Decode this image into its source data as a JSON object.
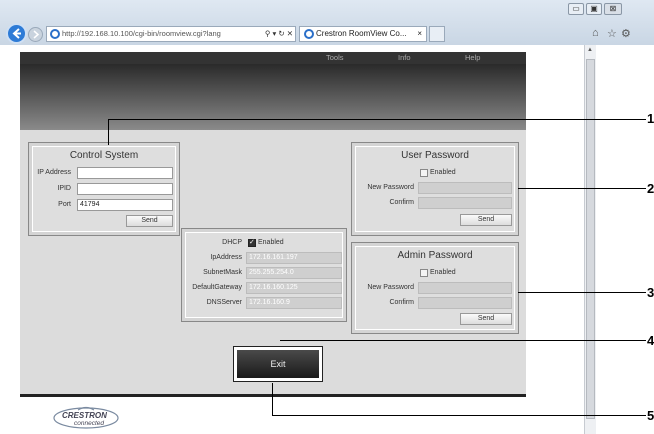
{
  "browser": {
    "url": "http://192.168.10.100/cgi-bin/roomview.cgi?lang",
    "tab_title": "Crestron RoomView Co...",
    "tab_close": "×",
    "win_min": "▭",
    "win_max": "▣",
    "win_close": "⊠"
  },
  "menu": {
    "tools": "Tools",
    "info": "Info",
    "help": "Help"
  },
  "control_system": {
    "title": "Control System",
    "ip_label": "IP Address",
    "ip_value": "",
    "ipid_label": "IPID",
    "ipid_value": "",
    "port_label": "Port",
    "port_value": "41794",
    "send": "Send"
  },
  "user_password": {
    "title": "User Password",
    "enabled": "Enabled",
    "new_label": "New Password",
    "confirm_label": "Confirm",
    "send": "Send"
  },
  "admin_password": {
    "title": "Admin Password",
    "enabled": "Enabled",
    "new_label": "New Password",
    "confirm_label": "Confirm",
    "send": "Send"
  },
  "network": {
    "dhcp_label": "DHCP",
    "dhcp_enabled": "Enabled",
    "ip_label": "IpAddress",
    "ip_value": "172.16.161.197",
    "subnet_label": "SubnetMask",
    "subnet_value": "255.255.254.0",
    "gateway_label": "DefaultGateway",
    "gateway_value": "172.16.160.125",
    "dns_label": "DNSServer",
    "dns_value": "172.16.160.9"
  },
  "exit_label": "Exit",
  "logo": {
    "brand": "CRESTRON",
    "tagline": "connected"
  },
  "callouts": [
    "1",
    "2",
    "3",
    "4",
    "5"
  ]
}
